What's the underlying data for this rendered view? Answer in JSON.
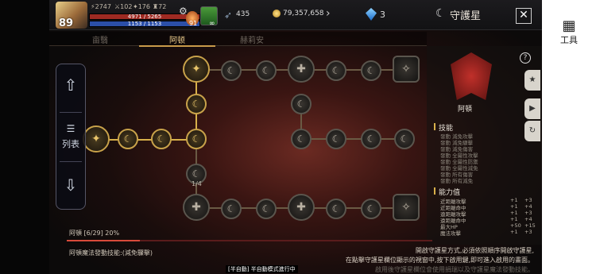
{
  "player": {
    "level": "89",
    "stat1": "2747",
    "stat2": "102",
    "stat3": "176",
    "stat4": "72",
    "hp": "4971 / 5265",
    "mp": "1153 / 1153",
    "potion_count": "91",
    "infinity": "∞"
  },
  "currency": {
    "item1": "435",
    "gold": "79,357,658",
    "gems": "3"
  },
  "window": {
    "title": "守護星",
    "close": "✕"
  },
  "tabs": [
    "亩翳",
    "阿顿",
    "赫莉安"
  ],
  "side": {
    "up": "⇧",
    "list_icon": "☰",
    "list": "列表",
    "down": "⇩"
  },
  "emblem": {
    "name": "阿頓"
  },
  "skills": {
    "header": "技能",
    "items": [
      "發動 減免攻擊",
      "發動 減免驟擊",
      "發動 減免傷害",
      "發動 全屬性攻擊",
      "發動 全屬性防禦",
      "發動 全屬性減免",
      "發動 所有傷害",
      "發動 所有減免",
      "發動 全屬性鈍化",
      "發動 全屬性傷害"
    ]
  },
  "abilities": {
    "header": "能力值",
    "rows": [
      {
        "name": "近距離攻擊",
        "v1": "+1",
        "v2": "+3"
      },
      {
        "name": "近距離命中",
        "v1": "+1",
        "v2": "+4"
      },
      {
        "name": "遠距離攻擊",
        "v1": "+1",
        "v2": "+3"
      },
      {
        "name": "遠距離命中",
        "v1": "+1",
        "v2": "+4"
      },
      {
        "name": "最大HP",
        "v1": "+50",
        "v2": "+15"
      },
      {
        "name": "魔法攻擊",
        "v1": "+1",
        "v2": "+3"
      }
    ]
  },
  "progress": {
    "label": "阿頓 [6/29] 20%",
    "percent": 20
  },
  "node_counter": "1/4",
  "footer": {
    "skill": "阿頓魔法發動技能:(減免驟擊)",
    "hint1": "開啟守護星方式,必須依照順序開啟守護星,",
    "hint2": "在點擊守護星欄位顯示的視窗中,按下啟用鍵,即可進入啟用的畫面。",
    "hint3": "啟用後守護星欄位會使用捐瑞以及守護星魔法發動技能。",
    "autorun": "[半自動] 半自動模式進行中"
  },
  "system": {
    "tools": "工具"
  }
}
